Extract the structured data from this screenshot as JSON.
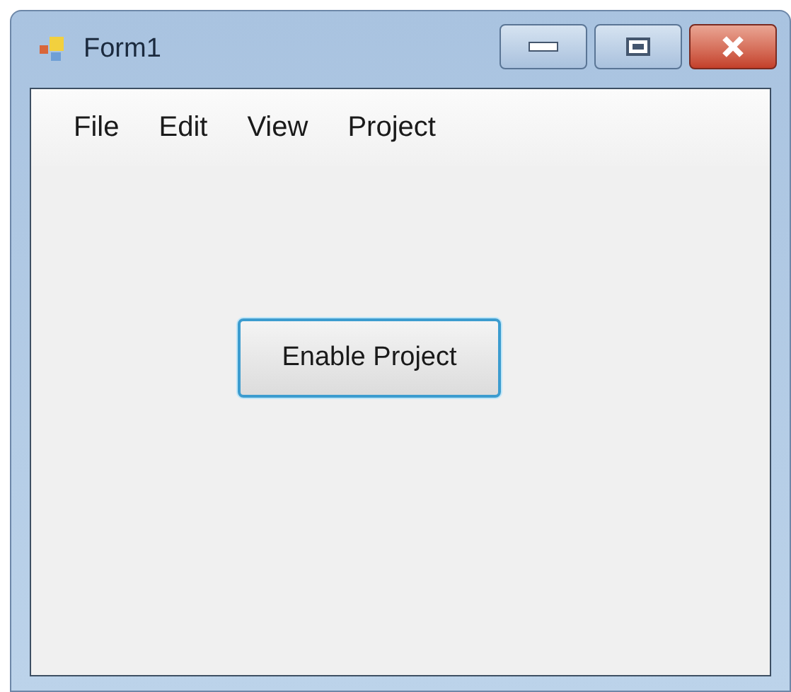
{
  "window": {
    "title": "Form1"
  },
  "menu": [
    {
      "label": "File"
    },
    {
      "label": "Edit"
    },
    {
      "label": "View"
    },
    {
      "label": "Project"
    }
  ],
  "button": {
    "label": "Enable Project",
    "focused": true
  }
}
